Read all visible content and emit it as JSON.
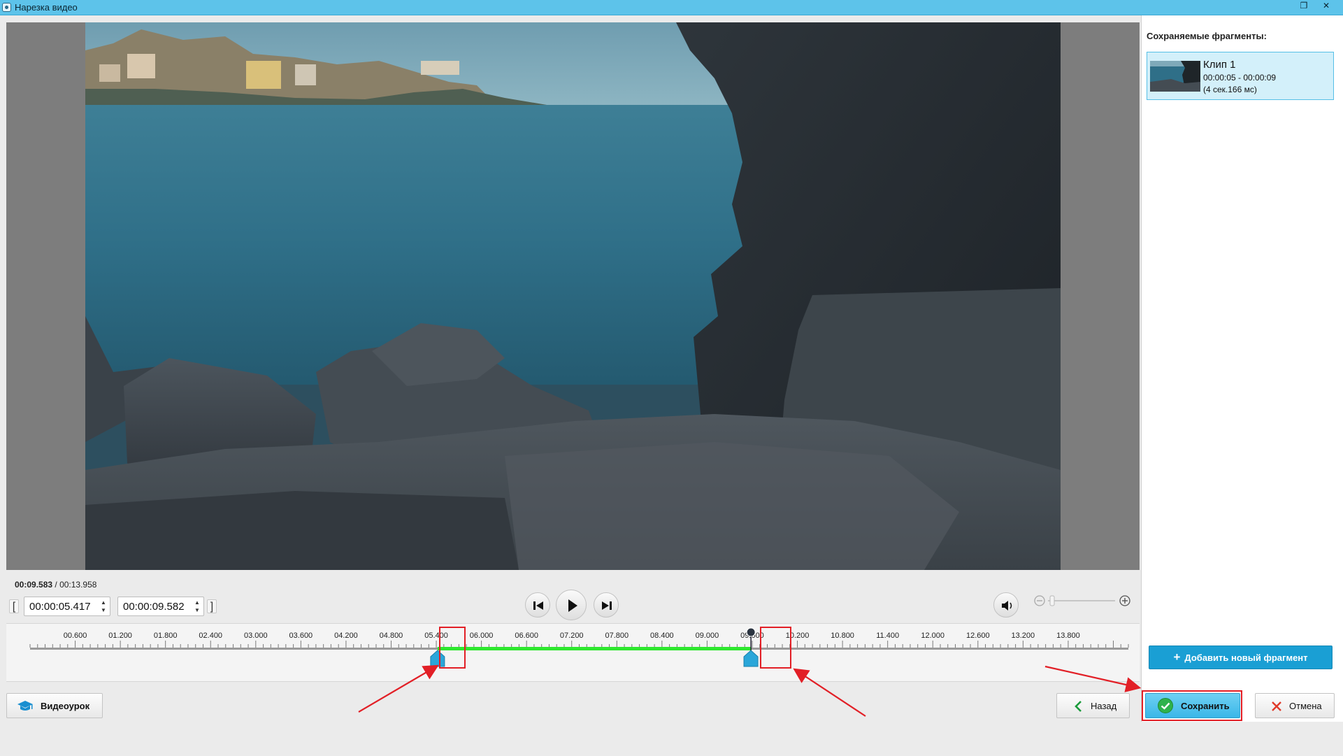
{
  "window": {
    "title": "Нарезка видео"
  },
  "player": {
    "current_time": "00:09.583",
    "separator": " / ",
    "total_time": "00:13.958",
    "start_field": "00:00:05.417",
    "end_field": "00:00:09.582"
  },
  "timeline": {
    "ticks": [
      "00.600",
      "01.200",
      "01.800",
      "02.400",
      "03.000",
      "03.600",
      "04.200",
      "04.800",
      "05.400",
      "06.000",
      "06.600",
      "07.200",
      "07.800",
      "08.400",
      "09.000",
      "09.600",
      "10.200",
      "10.800",
      "11.400",
      "12.000",
      "12.600",
      "13.200",
      "13.800"
    ],
    "duration_s": 13.958,
    "selection_start_s": 5.417,
    "selection_end_s": 9.582,
    "playhead_s": 9.583,
    "selection_color": "#2ee82e"
  },
  "panel": {
    "heading": "Сохраняемые фрагменты:",
    "clips": [
      {
        "name": "Клип 1",
        "range": "00:00:05 - 00:00:09",
        "duration": "(4 сек.166 мс)"
      }
    ],
    "add_button": "Добавить новый фрагмент"
  },
  "footer": {
    "tutorial_button": "Видеоурок",
    "back_button": "Назад",
    "save_button": "Сохранить",
    "cancel_button": "Отмена"
  },
  "colors": {
    "titlebar": "#5dc3ea",
    "accent": "#1a9fd4",
    "save_bg": "#4cc3ee",
    "annotation_red": "#e21f26"
  }
}
